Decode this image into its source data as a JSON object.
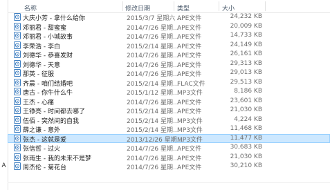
{
  "columns": {
    "name": "名称",
    "date": "修改日期",
    "type": "类型",
    "size": "大小"
  },
  "edge_text": "A",
  "files": [
    {
      "name": "大庆小芳 - 拿什么给你",
      "date": "2015/3/7 星期六 ...",
      "type": "APE文件",
      "size": "24,232 KB"
    },
    {
      "name": "邓丽君 - 甜蜜蜜",
      "date": "2014/7/26 星期...",
      "type": "APE文件",
      "size": "20,009 KB"
    },
    {
      "name": "邓丽君 - 小城故事",
      "date": "2014/7/26 星期...",
      "type": "APE文件",
      "size": "14,733 KB"
    },
    {
      "name": "李荣浩 - 李白",
      "date": "2015/2/14 星期...",
      "type": "APE文件",
      "size": "24,149 KB"
    },
    {
      "name": "刘德华 - 恭喜发财",
      "date": "2014/7/26 星期...",
      "type": "APE文件",
      "size": "26,161 KB"
    },
    {
      "name": "刘德华 - 天意",
      "date": "2014/7/26 星期...",
      "type": "APE文件",
      "size": "29,313 KB"
    },
    {
      "name": "那英 - 征服",
      "date": "2014/7/26 星期...",
      "type": "APE文件",
      "size": "29,013 KB"
    },
    {
      "name": "齐晨 - 咱们结婚吧",
      "date": "2015/2/14 星期...",
      "type": "FLAC文件",
      "size": "29,513 KB"
    },
    {
      "name": "唐古 - 你牛什么牛",
      "date": "2015/1/12 星期...",
      "type": "MP3文件",
      "size": "8,186 KB"
    },
    {
      "name": "王杰 - 心痛",
      "date": "2014/7/26 星期...",
      "type": "APE文件",
      "size": "23,601 KB"
    },
    {
      "name": "王铮亮 - 时间都去哪了",
      "date": "2015/2/14 星期...",
      "type": "APE文件",
      "size": "21,030 KB"
    },
    {
      "name": "伍佰 - 突然间的自我",
      "date": "2015/2/14 星期...",
      "type": "MP3文件",
      "size": "4,224 KB"
    },
    {
      "name": "薛之谦 - 意外",
      "date": "2015/2/14 星期...",
      "type": "MP3文件",
      "size": "11,468 KB"
    },
    {
      "name": "张杰 - 这就是爱",
      "date": "2013/12/26 星期...",
      "type": "MP3文件",
      "size": "11,477 KB",
      "selected": true
    },
    {
      "name": "张信哲 - 过火",
      "date": "2014/7/26 星期...",
      "type": "APE文件",
      "size": "30,683 KB"
    },
    {
      "name": "张雨生 - 我的未来不是梦",
      "date": "2014/7/26 星期...",
      "type": "APE文件",
      "size": "21,030 KB"
    },
    {
      "name": "周杰伦 - 菊花台",
      "date": "2014/7/26 星期...",
      "type": "APE文件",
      "size": "30,210 KB"
    }
  ],
  "colors": {
    "selection": "#cde8ff",
    "selection_border": "#99d1ff",
    "icon_blue": "#3f7fc1"
  },
  "file_icon": "audio-file-icon"
}
